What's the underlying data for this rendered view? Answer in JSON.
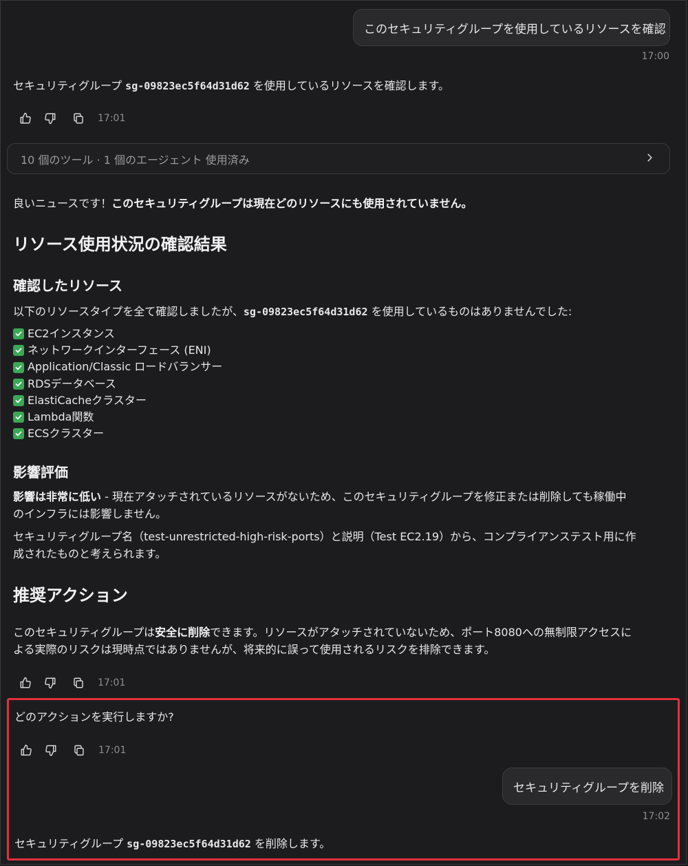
{
  "messages": {
    "user1": {
      "text": "このセキュリティグループを使用しているリソースを確認",
      "time": "17:00"
    },
    "assistant1": {
      "prefix": "セキュリティグループ ",
      "sg_id": "sg-09823ec5f64d31d62",
      "suffix": " を使用しているリソースを確認します。",
      "time": "17:01"
    },
    "tools_summary": "10 個のツール · 1 個のエージェント 使用済み",
    "result": {
      "intro_plain": "良いニュースです！",
      "intro_bold": "このセキュリティグループは現在どのリソースにも使用されていません。",
      "heading": "リソース使用状況の確認結果",
      "checked_heading": "確認したリソース",
      "checked_desc_prefix": "以下のリソースタイプを全て確認しましたが、",
      "checked_desc_sg": "sg-09823ec5f64d31d62",
      "checked_desc_suffix": " を使用しているものはありませんでした:",
      "checked_items": [
        "EC2インスタンス",
        "ネットワークインターフェース (ENI)",
        "Application/Classic ロードバランサー",
        "RDSデータベース",
        "ElastiCacheクラスター",
        "Lambda関数",
        "ECSクラスター"
      ],
      "impact_heading": "影響評価",
      "impact_bold": "影響は非常に低い",
      "impact_line1_rest": " - 現在アタッチされているリソースがないため、このセキュリティグループを修正または削除しても稼働中",
      "impact_line2": "のインフラには影響しません。",
      "name_line1": "セキュリティグループ名（test-unrestricted-high-risk-ports）と説明（Test EC2.19）から、コンプライアンステスト用に作",
      "name_line2": "成されたものと考えられます。",
      "action_heading": "推奨アクション",
      "action_prefix": "このセキュリティグループは",
      "action_bold": "安全に削除",
      "action_line1_rest": "できます。リソースがアタッチされていないため、ポート8080への無制限アクセスに",
      "action_line2": "よる実際のリスクは現時点ではありませんが、将来的に誤って使用されるリスクを排除できます。",
      "time": "17:01"
    },
    "question": {
      "text": "どのアクションを実行しますか?",
      "time": "17:01"
    },
    "user2": {
      "text": "セキュリティグループを削除",
      "time": "17:02"
    },
    "assistant_final": {
      "prefix": "セキュリティグループ ",
      "sg_id": "sg-09823ec5f64d31d62",
      "suffix": " を削除します。"
    }
  },
  "icons": {
    "like": "thumbs-up-icon",
    "dislike": "thumbs-down-icon",
    "copy": "copy-icon",
    "expand": "chevron-right-icon",
    "check": "check-icon"
  },
  "colors": {
    "background": "#1c1c1e",
    "highlight": "#e3303c",
    "check": "#3aa856"
  }
}
